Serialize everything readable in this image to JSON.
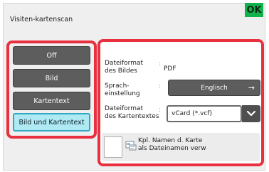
{
  "window": {
    "title": "Visiten-kartenscan",
    "ok_label": "OK"
  },
  "modes": {
    "items": [
      {
        "label": "Off",
        "selected": false
      },
      {
        "label": "Bild",
        "selected": false
      },
      {
        "label": "Kartentext",
        "selected": false
      },
      {
        "label": "Bild und Kartentext",
        "selected": true
      }
    ]
  },
  "settings": {
    "image_format": {
      "label_line1": "Dateiformat",
      "label_line2": "des Bildes",
      "value": "PDF"
    },
    "language": {
      "label_line1": "Sprach-",
      "label_line2": "einstellung",
      "value": "Englisch"
    },
    "text_format": {
      "label_line1": "Dateiformat",
      "label_line2": "des Kartentextes",
      "value": "vCard (*.vcf)"
    },
    "filename_option": {
      "label_line1": "Kpl. Namen d. Karte",
      "label_line2": "als Dateinamen verw",
      "checked": false
    }
  },
  "colors": {
    "highlight": "#e8303f",
    "ok": "#12b34c",
    "selected_bg": "#aee9f4",
    "button_bg": "#5d5d5d"
  }
}
